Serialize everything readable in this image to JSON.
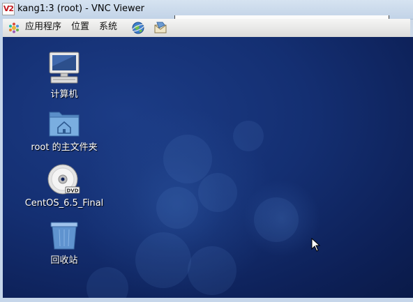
{
  "window": {
    "title": "kang1:3 (root) - VNC Viewer",
    "logo_text": "V2"
  },
  "panel": {
    "menus": [
      {
        "label": "应用程序",
        "icon": "gnome-foot-icon"
      },
      {
        "label": "位置"
      },
      {
        "label": "系统"
      }
    ],
    "launchers": [
      "web-browser-icon",
      "mail-client-icon"
    ]
  },
  "desktop": {
    "icons": [
      {
        "label": "计算机",
        "icon": "computer-icon"
      },
      {
        "label": "root 的主文件夹",
        "icon": "home-folder-icon"
      },
      {
        "label": "CentOS_6.5_Final",
        "icon": "dvd-icon",
        "badge": "DVD"
      },
      {
        "label": "回收站",
        "icon": "trash-icon"
      }
    ]
  },
  "colors": {
    "desktop_dark": "#0d2057",
    "desktop_mid": "#1c3c86",
    "titlebar": "#c2d3e7"
  }
}
